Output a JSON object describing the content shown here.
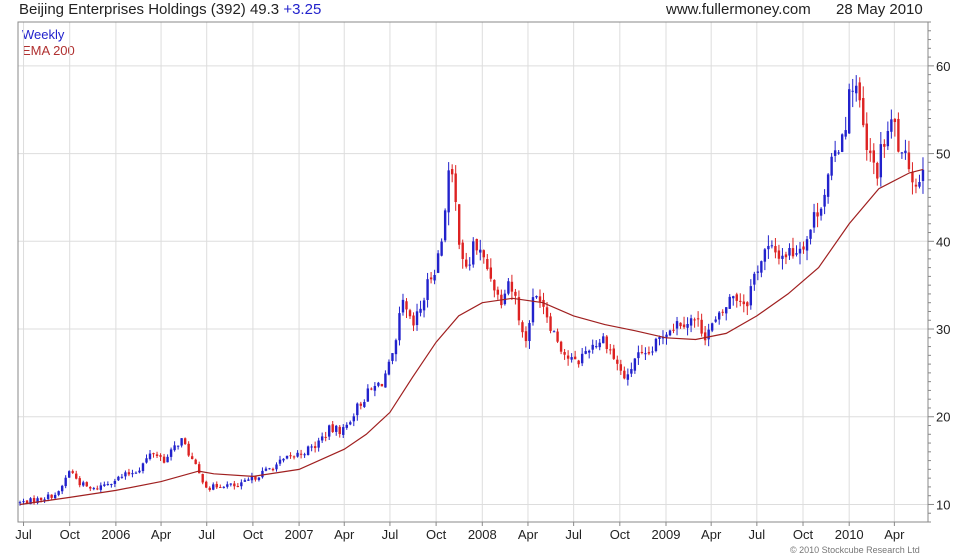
{
  "header": {
    "title": "Beijing Enterprises Holdings (392) 49.3",
    "change": "+3.25",
    "site": "www.fullermoney.com",
    "date": "28 May 2010"
  },
  "copyright": "© 2010 Stockcube Research Ltd",
  "colors": {
    "up": "#2222cc",
    "down": "#dd2222",
    "ema": "#a02020",
    "grid": "#dddddd",
    "frame": "#888888"
  },
  "chart_data": {
    "type": "candlestick",
    "title": "Beijing Enterprises Holdings (392) 49.3 +3.25",
    "legend": [
      "Weekly",
      "EMA 200"
    ],
    "legend_position": "top-left",
    "grid": true,
    "ylim": [
      8,
      65
    ],
    "y_ticks": [
      10,
      20,
      30,
      40,
      50,
      60
    ],
    "y_axis_side": "right",
    "xlim": [
      "2005-06-20",
      "2010-06-07"
    ],
    "x_ticks": [
      {
        "label": "Jul",
        "date": "2005-07-01"
      },
      {
        "label": "Oct",
        "date": "2005-10-01"
      },
      {
        "label": "2006",
        "date": "2006-01-01"
      },
      {
        "label": "Apr",
        "date": "2006-04-01"
      },
      {
        "label": "Jul",
        "date": "2006-07-01"
      },
      {
        "label": "Oct",
        "date": "2006-10-01"
      },
      {
        "label": "2007",
        "date": "2007-01-01"
      },
      {
        "label": "Apr",
        "date": "2007-04-01"
      },
      {
        "label": "Jul",
        "date": "2007-07-01"
      },
      {
        "label": "Oct",
        "date": "2007-10-01"
      },
      {
        "label": "2008",
        "date": "2008-01-01"
      },
      {
        "label": "Apr",
        "date": "2008-04-01"
      },
      {
        "label": "Jul",
        "date": "2008-07-01"
      },
      {
        "label": "Oct",
        "date": "2008-10-01"
      },
      {
        "label": "2009",
        "date": "2009-01-01"
      },
      {
        "label": "Apr",
        "date": "2009-04-01"
      },
      {
        "label": "Jul",
        "date": "2009-07-01"
      },
      {
        "label": "Oct",
        "date": "2009-10-01"
      },
      {
        "label": "2010",
        "date": "2010-01-01"
      },
      {
        "label": "Apr",
        "date": "2010-04-01"
      }
    ],
    "close_path": [
      [
        "2005-06-24",
        10.2
      ],
      [
        "2005-08-01",
        10.6
      ],
      [
        "2005-09-10",
        11.3
      ],
      [
        "2005-10-01",
        14.0
      ],
      [
        "2005-10-20",
        12.5
      ],
      [
        "2005-11-15",
        11.6
      ],
      [
        "2005-12-15",
        12.5
      ],
      [
        "2006-01-15",
        13.2
      ],
      [
        "2006-02-15",
        14.0
      ],
      [
        "2006-03-15",
        16.0
      ],
      [
        "2006-04-10",
        15.0
      ],
      [
        "2006-05-10",
        17.5
      ],
      [
        "2006-05-25",
        16.0
      ],
      [
        "2006-06-15",
        13.5
      ],
      [
        "2006-07-05",
        11.8
      ],
      [
        "2006-08-01",
        12.3
      ],
      [
        "2006-09-01",
        12.0
      ],
      [
        "2006-10-01",
        13.0
      ],
      [
        "2006-11-01",
        14.0
      ],
      [
        "2006-12-01",
        15.0
      ],
      [
        "2007-01-01",
        15.8
      ],
      [
        "2007-02-01",
        16.6
      ],
      [
        "2007-03-01",
        18.5
      ],
      [
        "2007-04-01",
        18.5
      ],
      [
        "2007-04-20",
        20.5
      ],
      [
        "2007-05-15",
        22.5
      ],
      [
        "2007-06-15",
        24.0
      ],
      [
        "2007-07-10",
        27.0
      ],
      [
        "2007-07-25",
        33.0
      ],
      [
        "2007-08-15",
        30.0
      ],
      [
        "2007-09-01",
        32.5
      ],
      [
        "2007-09-20",
        36.0
      ],
      [
        "2007-10-10",
        39.0
      ],
      [
        "2007-10-25",
        48.0
      ],
      [
        "2007-11-05",
        46.0
      ],
      [
        "2007-11-15",
        41.0
      ],
      [
        "2007-12-01",
        36.0
      ],
      [
        "2007-12-15",
        40.0
      ],
      [
        "2008-01-01",
        38.0
      ],
      [
        "2008-01-20",
        36.0
      ],
      [
        "2008-02-05",
        33.0
      ],
      [
        "2008-02-20",
        36.0
      ],
      [
        "2008-03-10",
        33.0
      ],
      [
        "2008-03-25",
        28.0
      ],
      [
        "2008-04-10",
        33.0
      ],
      [
        "2008-04-25",
        34.0
      ],
      [
        "2008-05-20",
        30.0
      ],
      [
        "2008-06-15",
        27.0
      ],
      [
        "2008-07-05",
        26.0
      ],
      [
        "2008-08-01",
        28.0
      ],
      [
        "2008-09-01",
        29.0
      ],
      [
        "2008-09-25",
        26.0
      ],
      [
        "2008-10-15",
        24.0
      ],
      [
        "2008-11-01",
        27.0
      ],
      [
        "2008-11-20",
        26.5
      ],
      [
        "2008-12-10",
        28.0
      ],
      [
        "2009-01-01",
        30.0
      ],
      [
        "2009-02-01",
        31.0
      ],
      [
        "2009-03-01",
        31.0
      ],
      [
        "2009-03-20",
        29.5
      ],
      [
        "2009-04-15",
        31.0
      ],
      [
        "2009-05-15",
        34.0
      ],
      [
        "2009-06-10",
        33.0
      ],
      [
        "2009-07-01",
        37.0
      ],
      [
        "2009-07-20",
        39.0
      ],
      [
        "2009-08-20",
        38.5
      ],
      [
        "2009-09-15",
        39.0
      ],
      [
        "2009-10-10",
        40.5
      ],
      [
        "2009-10-25",
        43.0
      ],
      [
        "2009-11-15",
        46.0
      ],
      [
        "2009-12-10",
        51.0
      ],
      [
        "2009-12-25",
        54.0
      ],
      [
        "2010-01-10",
        59.0
      ],
      [
        "2010-01-20",
        56.0
      ],
      [
        "2010-02-05",
        50.0
      ],
      [
        "2010-02-25",
        48.0
      ],
      [
        "2010-03-15",
        52.0
      ],
      [
        "2010-04-01",
        53.5
      ],
      [
        "2010-04-15",
        49.0
      ],
      [
        "2010-05-01",
        49.0
      ],
      [
        "2010-05-15",
        46.0
      ],
      [
        "2010-05-28",
        49.3
      ]
    ],
    "ema_200": [
      [
        "2005-06-24",
        10.0
      ],
      [
        "2005-10-01",
        10.8
      ],
      [
        "2006-01-01",
        11.6
      ],
      [
        "2006-04-01",
        12.6
      ],
      [
        "2006-06-15",
        13.8
      ],
      [
        "2006-07-15",
        13.5
      ],
      [
        "2006-10-01",
        13.2
      ],
      [
        "2007-01-01",
        14.0
      ],
      [
        "2007-04-01",
        16.3
      ],
      [
        "2007-05-15",
        18.0
      ],
      [
        "2007-07-01",
        20.5
      ],
      [
        "2007-08-15",
        24.5
      ],
      [
        "2007-10-01",
        28.5
      ],
      [
        "2007-11-15",
        31.5
      ],
      [
        "2008-01-01",
        33.0
      ],
      [
        "2008-03-01",
        33.5
      ],
      [
        "2008-05-01",
        33.0
      ],
      [
        "2008-07-01",
        31.5
      ],
      [
        "2008-09-01",
        30.5
      ],
      [
        "2008-11-01",
        29.8
      ],
      [
        "2009-01-01",
        29.0
      ],
      [
        "2009-03-01",
        28.8
      ],
      [
        "2009-05-01",
        29.5
      ],
      [
        "2009-07-01",
        31.5
      ],
      [
        "2009-09-01",
        34.0
      ],
      [
        "2009-11-01",
        37.0
      ],
      [
        "2010-01-01",
        42.0
      ],
      [
        "2010-03-01",
        46.0
      ],
      [
        "2010-05-01",
        47.8
      ],
      [
        "2010-05-28",
        48.2
      ]
    ]
  }
}
